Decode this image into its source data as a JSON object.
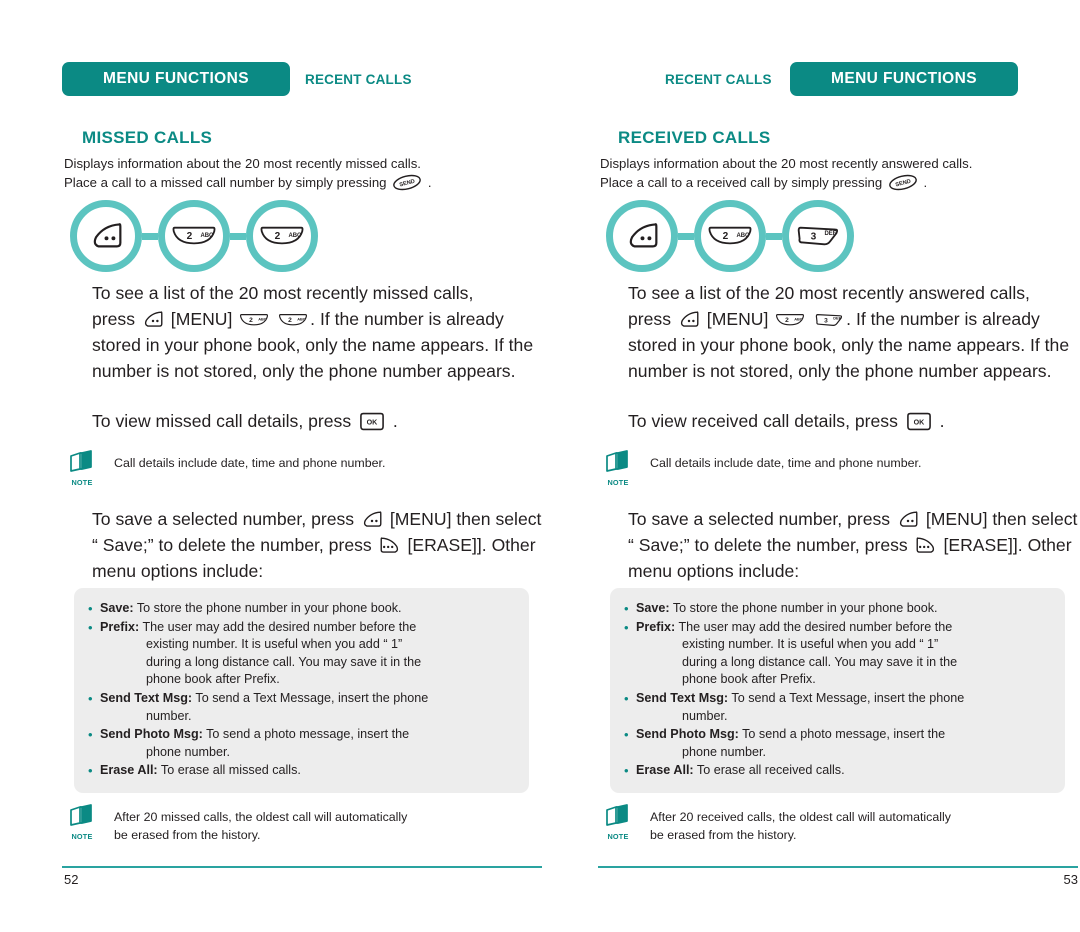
{
  "theme": {
    "teal_dark": "#0b8a84",
    "teal_light": "#5cc4c0",
    "grey_box": "#ededed",
    "rule": "#2aa3a0",
    "text": "#231f20"
  },
  "pages": [
    {
      "header": {
        "bar_label": "MENU FUNCTIONS",
        "side_label": "RECENT CALLS",
        "bar_side": "left"
      },
      "section_title": "MISSED CALLS",
      "intro_line1": "Displays information about the 20 most recently missed calls.",
      "intro_line2_before": "Place a call to a missed call number by simply pressing",
      "intro_line2_after": ".",
      "keyflow": [
        {
          "icon": "menu-key",
          "label": ""
        },
        {
          "icon": "number-key",
          "digit": "2",
          "letters": "ABC"
        },
        {
          "icon": "number-key",
          "digit": "2",
          "letters": "ABC"
        }
      ],
      "para_1": {
        "a": "To see a list of the 20 most recently missed calls,",
        "b": "press",
        "c": "[MENU]",
        "keys": [
          {
            "digit": "2",
            "letters": "ABC"
          },
          {
            "digit": "2",
            "letters": "ABC"
          }
        ],
        "d": ". If the number is already stored in your phone book, only the name appears. If the number is not stored, only the phone number appears."
      },
      "para_2": {
        "a": "To view missed call details, press",
        "b": "."
      },
      "note_1": "Call details include date, time and phone number.",
      "para_3": {
        "a": "To save a selected number, press",
        "b": "[MENU] then select “ Save;” to delete the number, press",
        "c": "[ERASE]].  Other menu options include:"
      },
      "options": [
        {
          "label": "Save:",
          "desc": "To store the phone number in your phone book.",
          "cont": []
        },
        {
          "label": "Prefix:",
          "desc": "The user may add the desired number before the",
          "cont": [
            "existing number. It is useful when you add “ 1”",
            "during a long distance call. You may save it in the",
            "phone book after Prefix."
          ]
        },
        {
          "label": "Send Text Msg:",
          "desc": "To send a Text Message, insert the phone",
          "cont": [
            "number."
          ]
        },
        {
          "label": "Send Photo Msg:",
          "desc": "To send a photo message, insert the",
          "cont": [
            "phone number."
          ]
        },
        {
          "label": "Erase All:",
          "desc": "To erase all missed calls.",
          "cont": []
        }
      ],
      "note_2_line1": "After 20 missed calls, the oldest call will automatically",
      "note_2_line2": "be erased from the history.",
      "note_label": "NOTE",
      "page_number": "52"
    },
    {
      "header": {
        "bar_label": "MENU FUNCTIONS",
        "side_label": "RECENT CALLS",
        "bar_side": "right"
      },
      "section_title": "RECEIVED CALLS",
      "intro_line1": "Displays information about the 20 most recently answered calls.",
      "intro_line2_before": "Place a call to a received call by simply pressing",
      "intro_line2_after": ".",
      "keyflow": [
        {
          "icon": "menu-key",
          "label": ""
        },
        {
          "icon": "number-key",
          "digit": "2",
          "letters": "ABC"
        },
        {
          "icon": "number-key",
          "digit": "3",
          "letters": "DEF"
        }
      ],
      "para_1": {
        "a": "To see a list of the 20 most recently answered calls,",
        "b": "press",
        "c": "[MENU]",
        "keys": [
          {
            "digit": "2",
            "letters": "ABC"
          },
          {
            "digit": "3",
            "letters": "DEF"
          }
        ],
        "d": ". If the number is already stored in your phone book, only the name appears. If the number is not stored, only the phone number appears."
      },
      "para_2": {
        "a": "To view received call details, press",
        "b": "."
      },
      "note_1": "Call details include date, time and phone number.",
      "para_3": {
        "a": "To save a selected number, press",
        "b": "[MENU] then select “ Save;” to delete the number, press",
        "c": "[ERASE]].  Other menu options include:"
      },
      "options": [
        {
          "label": "Save:",
          "desc": "To store the phone number in your phone book.",
          "cont": []
        },
        {
          "label": "Prefix:",
          "desc": "The user may add the desired number before the",
          "cont": [
            "existing number. It is useful when you add “ 1”",
            "during a long distance call. You may save it in the",
            "phone book after Prefix."
          ]
        },
        {
          "label": "Send Text Msg:",
          "desc": "To send a Text Message, insert the phone",
          "cont": [
            "number."
          ]
        },
        {
          "label": "Send Photo Msg:",
          "desc": "To send a photo message, insert the",
          "cont": [
            "phone number."
          ]
        },
        {
          "label": "Erase All:",
          "desc": "To erase all received calls.",
          "cont": []
        }
      ],
      "note_2_line1": "After 20 received calls, the oldest call will automatically",
      "note_2_line2": "be erased from the history.",
      "note_label": "NOTE",
      "page_number": "53"
    }
  ],
  "icons": {
    "send_key": "SEND",
    "ok_key": "OK",
    "menu_key": "menu-key",
    "erase_key": "erase-key"
  }
}
